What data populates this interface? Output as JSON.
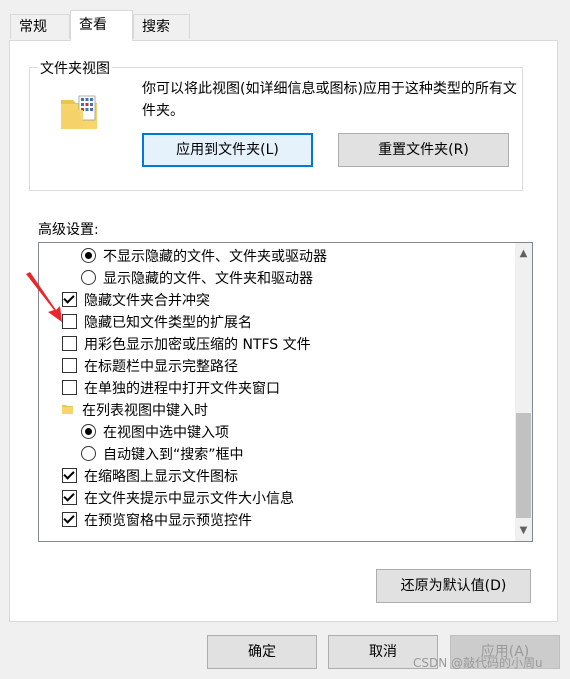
{
  "tabs": [
    {
      "label": "常规",
      "active": false
    },
    {
      "label": "查看",
      "active": true
    },
    {
      "label": "搜索",
      "active": false
    }
  ],
  "folder_views": {
    "title": "文件夹视图",
    "description": "你可以将此视图(如详细信息或图标)应用于这种类型的所有文件夹。",
    "apply_button": "应用到文件夹(L)",
    "reset_button": "重置文件夹(R)",
    "folder_icon": "folder-icon"
  },
  "advanced": {
    "label": "高级设置:",
    "items": [
      {
        "type": "radio",
        "checked": true,
        "indent": 1,
        "label": "不显示隐藏的文件、文件夹或驱动器"
      },
      {
        "type": "radio",
        "checked": false,
        "indent": 1,
        "label": "显示隐藏的文件、文件夹和驱动器"
      },
      {
        "type": "checkbox",
        "checked": true,
        "indent": 0,
        "label": "隐藏文件夹合并冲突"
      },
      {
        "type": "checkbox",
        "checked": false,
        "indent": 0,
        "label": "隐藏已知文件类型的扩展名"
      },
      {
        "type": "checkbox",
        "checked": false,
        "indent": 0,
        "label": "用彩色显示加密或压缩的 NTFS 文件"
      },
      {
        "type": "checkbox",
        "checked": false,
        "indent": 0,
        "label": "在标题栏中显示完整路径"
      },
      {
        "type": "checkbox",
        "checked": false,
        "indent": 0,
        "label": "在单独的进程中打开文件夹窗口"
      },
      {
        "type": "folder",
        "indent": 0,
        "label": "在列表视图中键入时"
      },
      {
        "type": "radio",
        "checked": true,
        "indent": 1,
        "label": "在视图中选中键入项"
      },
      {
        "type": "radio",
        "checked": false,
        "indent": 1,
        "label": "自动键入到“搜索”框中"
      },
      {
        "type": "checkbox",
        "checked": true,
        "indent": 0,
        "label": "在缩略图上显示文件图标"
      },
      {
        "type": "checkbox",
        "checked": true,
        "indent": 0,
        "label": "在文件夹提示中显示文件大小信息"
      },
      {
        "type": "checkbox",
        "checked": true,
        "indent": 0,
        "label": "在预览窗格中显示预览控件"
      }
    ]
  },
  "restore_defaults": "还原为默认值(D)",
  "footer": {
    "ok": "确定",
    "cancel": "取消",
    "apply": "应用(A)"
  },
  "annotation_color": "#e8262b",
  "watermark": "CSDN @敲代码的小周u"
}
